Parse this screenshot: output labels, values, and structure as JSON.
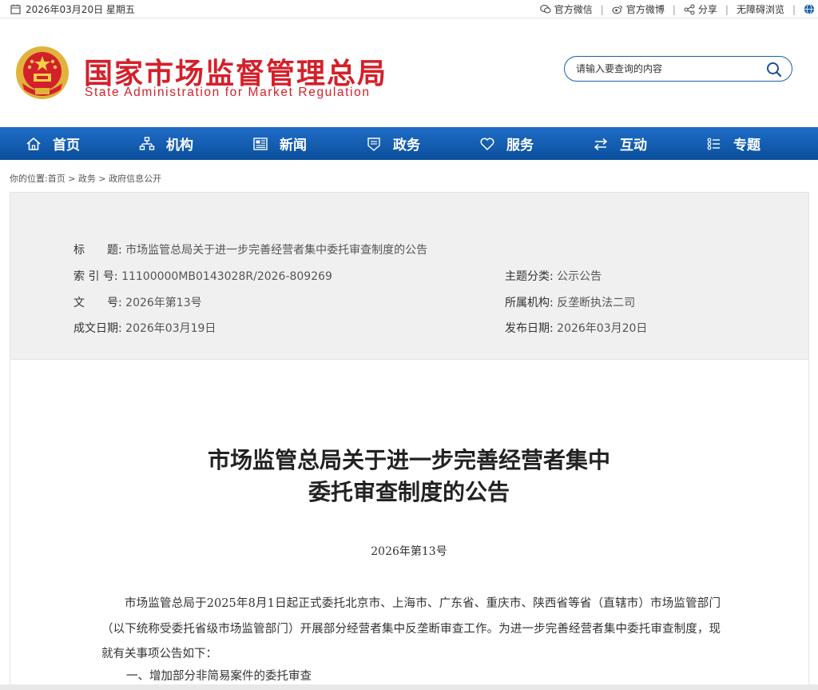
{
  "topbar": {
    "date": "2026年03月20日 星期五",
    "links": [
      "官方微信",
      "官方微博",
      "分享",
      "无障碍浏览"
    ]
  },
  "header": {
    "title_cn": "国家市场监督管理总局",
    "title_en": "State Administration for Market Regulation",
    "search_placeholder": "请输入要查询的内容"
  },
  "nav": [
    {
      "label": "首页",
      "icon": "home-icon"
    },
    {
      "label": "机构",
      "icon": "org-chart-icon"
    },
    {
      "label": "新闻",
      "icon": "news-icon"
    },
    {
      "label": "政务",
      "icon": "government-affairs-icon"
    },
    {
      "label": "服务",
      "icon": "heart-icon"
    },
    {
      "label": "互动",
      "icon": "exchange-arrows-icon"
    },
    {
      "label": "专题",
      "icon": "list-icon"
    }
  ],
  "breadcrumb": "你的位置:首页 > 政务 > 政府信息公开",
  "info": {
    "title_label": "标　　题:",
    "title_value": "市场监管总局关于进一步完善经营者集中委托审查制度的公告",
    "index_label": "索 引 号:",
    "index_value": "11100000MB0143028R/2026-809269",
    "doc_label": "文　　号:",
    "doc_value": "2026年第13号",
    "created_label": "成文日期:",
    "created_value": "2026年03月19日",
    "topic_label": "主题分类:",
    "topic_value": "公示公告",
    "org_label": "所属机构:",
    "org_value": "反垄断执法二司",
    "published_label": "发布日期:",
    "published_value": "2026年03月20日"
  },
  "article": {
    "title_line1": "市场监管总局关于进一步完善经营者集中",
    "title_line2": "委托审查制度的公告",
    "doc_number": "2026年第13号",
    "paragraph1": "市场监管总局于2025年8月1日起正式委托北京市、上海市、广东省、重庆市、陕西省等省（直辖市）市场监管部门（以下统称受委托省级市场监管部门）开展部分经营者集中反垄断审查工作。为进一步完善经营者集中委托审查制度，现就有关事项公告如下：",
    "heading1": "一、增加部分非简易案件的委托审查"
  },
  "colors": {
    "brand_red": "#d4202a",
    "nav_blue": "#0b4f9c",
    "info_bg": "#f0f0f0"
  }
}
